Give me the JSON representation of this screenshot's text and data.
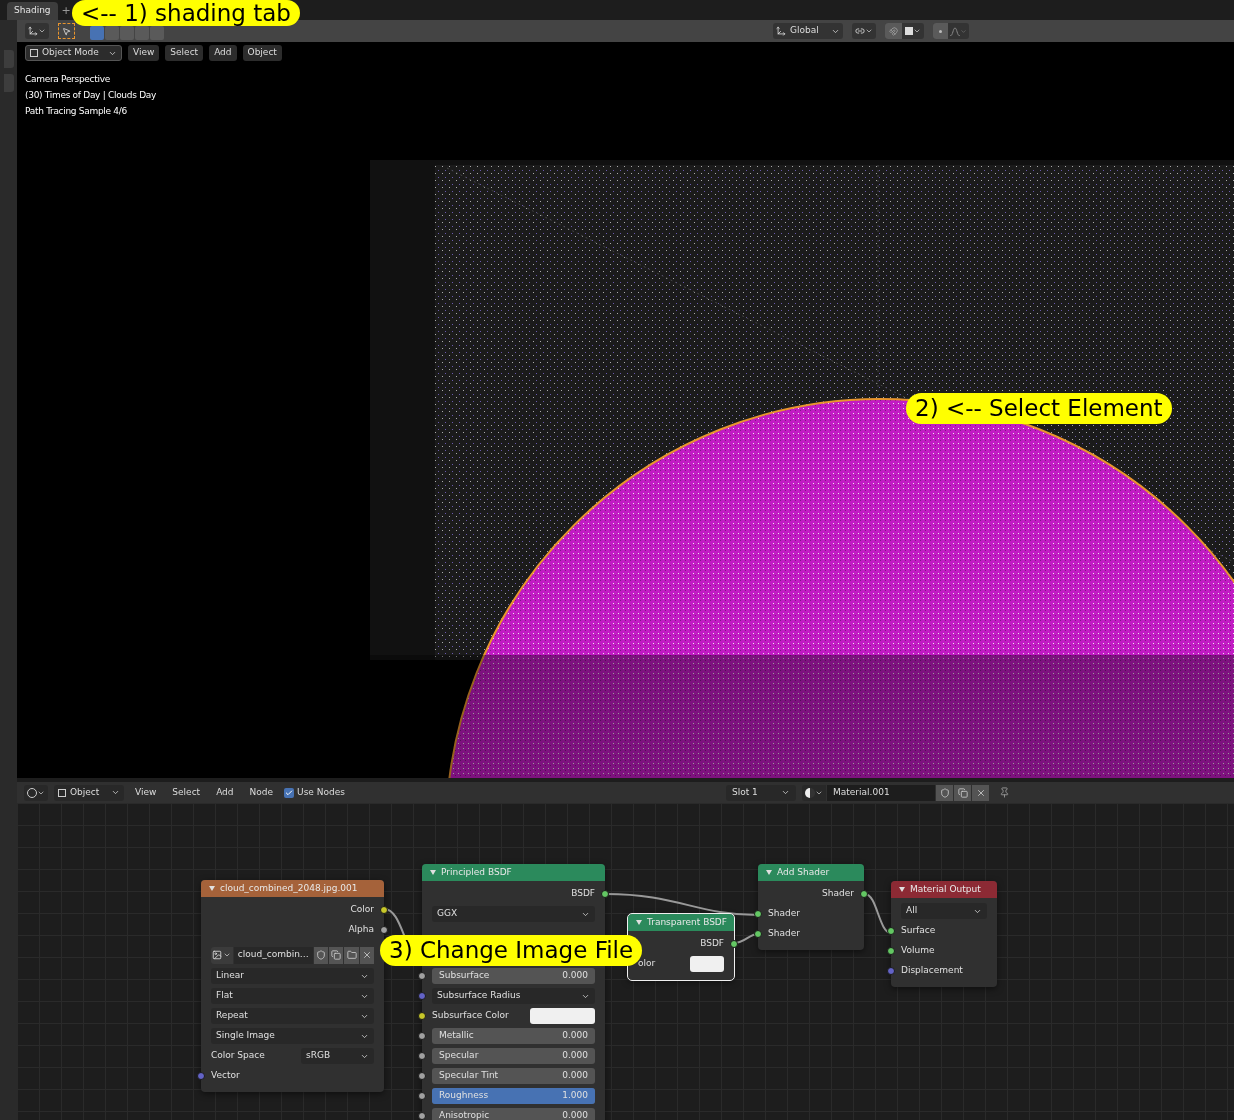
{
  "workspace_tabs": [
    {
      "label": "Shading",
      "selected": true
    }
  ],
  "add_tab": "+",
  "annotations": [
    {
      "text": "<-- 1) shading tab"
    },
    {
      "text": "2) <-- Select Element"
    },
    {
      "text": "3) Change Image File"
    }
  ],
  "toolbar": {
    "orientation": "Global"
  },
  "viewport": {
    "mode": "Object Mode",
    "menus": [
      "View",
      "Select",
      "Add",
      "Object"
    ],
    "overlay_lines": [
      "Camera Perspective",
      "(30) Times of Day | Clouds Day",
      "Path Tracing Sample 4/6"
    ]
  },
  "node_editor": {
    "mode": "Object",
    "menus": [
      "View",
      "Select",
      "Add",
      "Node"
    ],
    "use_nodes": {
      "label": "Use Nodes",
      "checked": true
    },
    "slot": "Slot 1",
    "material": "Material.001",
    "nodes": [
      {
        "title": "cloud_combined_2048.jpg.001",
        "color": "#a5623a",
        "selected": false,
        "rows": [
          {
            "kind": "output",
            "label": "Color",
            "color": "#c7c729"
          },
          {
            "kind": "output",
            "label": "Alpha",
            "color": "#a1a1a1"
          },
          {
            "kind": "image_selector",
            "value": "cloud_combin…"
          },
          {
            "kind": "dropdown",
            "value": "Linear"
          },
          {
            "kind": "dropdown",
            "value": "Flat"
          },
          {
            "kind": "dropdown",
            "value": "Repeat"
          },
          {
            "kind": "dropdown",
            "value": "Single Image"
          },
          {
            "kind": "labeled_dropdown",
            "label": "Color Space",
            "value": "sRGB"
          },
          {
            "kind": "input",
            "label": "Vector",
            "color": "#6363c7"
          }
        ]
      },
      {
        "title": "Principled BSDF",
        "color": "#2b8a5c",
        "selected": false,
        "rows": [
          {
            "kind": "output",
            "label": "BSDF",
            "color": "#63c763"
          },
          {
            "kind": "dropdown",
            "value": "GGX"
          },
          {
            "kind": "slider",
            "label": "Subsurface",
            "value": "0.000",
            "level": 0,
            "color": "#a1a1a1"
          },
          {
            "kind": "dropdown",
            "value": "Subsurface Radius",
            "color": "#6363c7"
          },
          {
            "kind": "color",
            "label": "Subsurface Color",
            "color": "#c7c729"
          },
          {
            "kind": "slider",
            "label": "Metallic",
            "value": "0.000",
            "level": 0,
            "color": "#a1a1a1"
          },
          {
            "kind": "slider",
            "label": "Specular",
            "value": "0.000",
            "level": 0,
            "color": "#a1a1a1"
          },
          {
            "kind": "slider",
            "label": "Specular Tint",
            "value": "0.000",
            "level": 0,
            "color": "#a1a1a1"
          },
          {
            "kind": "slider",
            "label": "Roughness",
            "value": "1.000",
            "level": 1,
            "color": "#a1a1a1"
          },
          {
            "kind": "slider",
            "label": "Anisotropic",
            "value": "0.000",
            "level": 0,
            "color": "#a1a1a1"
          }
        ]
      },
      {
        "title": "Transparent BSDF",
        "color": "#2b8a5c",
        "selected": true,
        "rows": [
          {
            "kind": "output",
            "label": "BSDF",
            "color": "#63c763"
          },
          {
            "kind": "color",
            "label": "olor"
          }
        ]
      },
      {
        "title": "Add Shader",
        "color": "#2b8a5c",
        "selected": false,
        "rows": [
          {
            "kind": "output",
            "label": "Shader",
            "color": "#63c763"
          },
          {
            "kind": "input",
            "label": "Shader",
            "color": "#63c763"
          },
          {
            "kind": "input",
            "label": "Shader",
            "color": "#63c763"
          }
        ]
      },
      {
        "title": "Material Output",
        "color": "#8c2a34",
        "selected": false,
        "rows": [
          {
            "kind": "dropdown",
            "value": "All"
          },
          {
            "kind": "input",
            "label": "Surface",
            "color": "#63c763"
          },
          {
            "kind": "input",
            "label": "Volume",
            "color": "#63c763"
          },
          {
            "kind": "input",
            "label": "Displacement",
            "color": "#6363c7"
          }
        ]
      }
    ]
  }
}
